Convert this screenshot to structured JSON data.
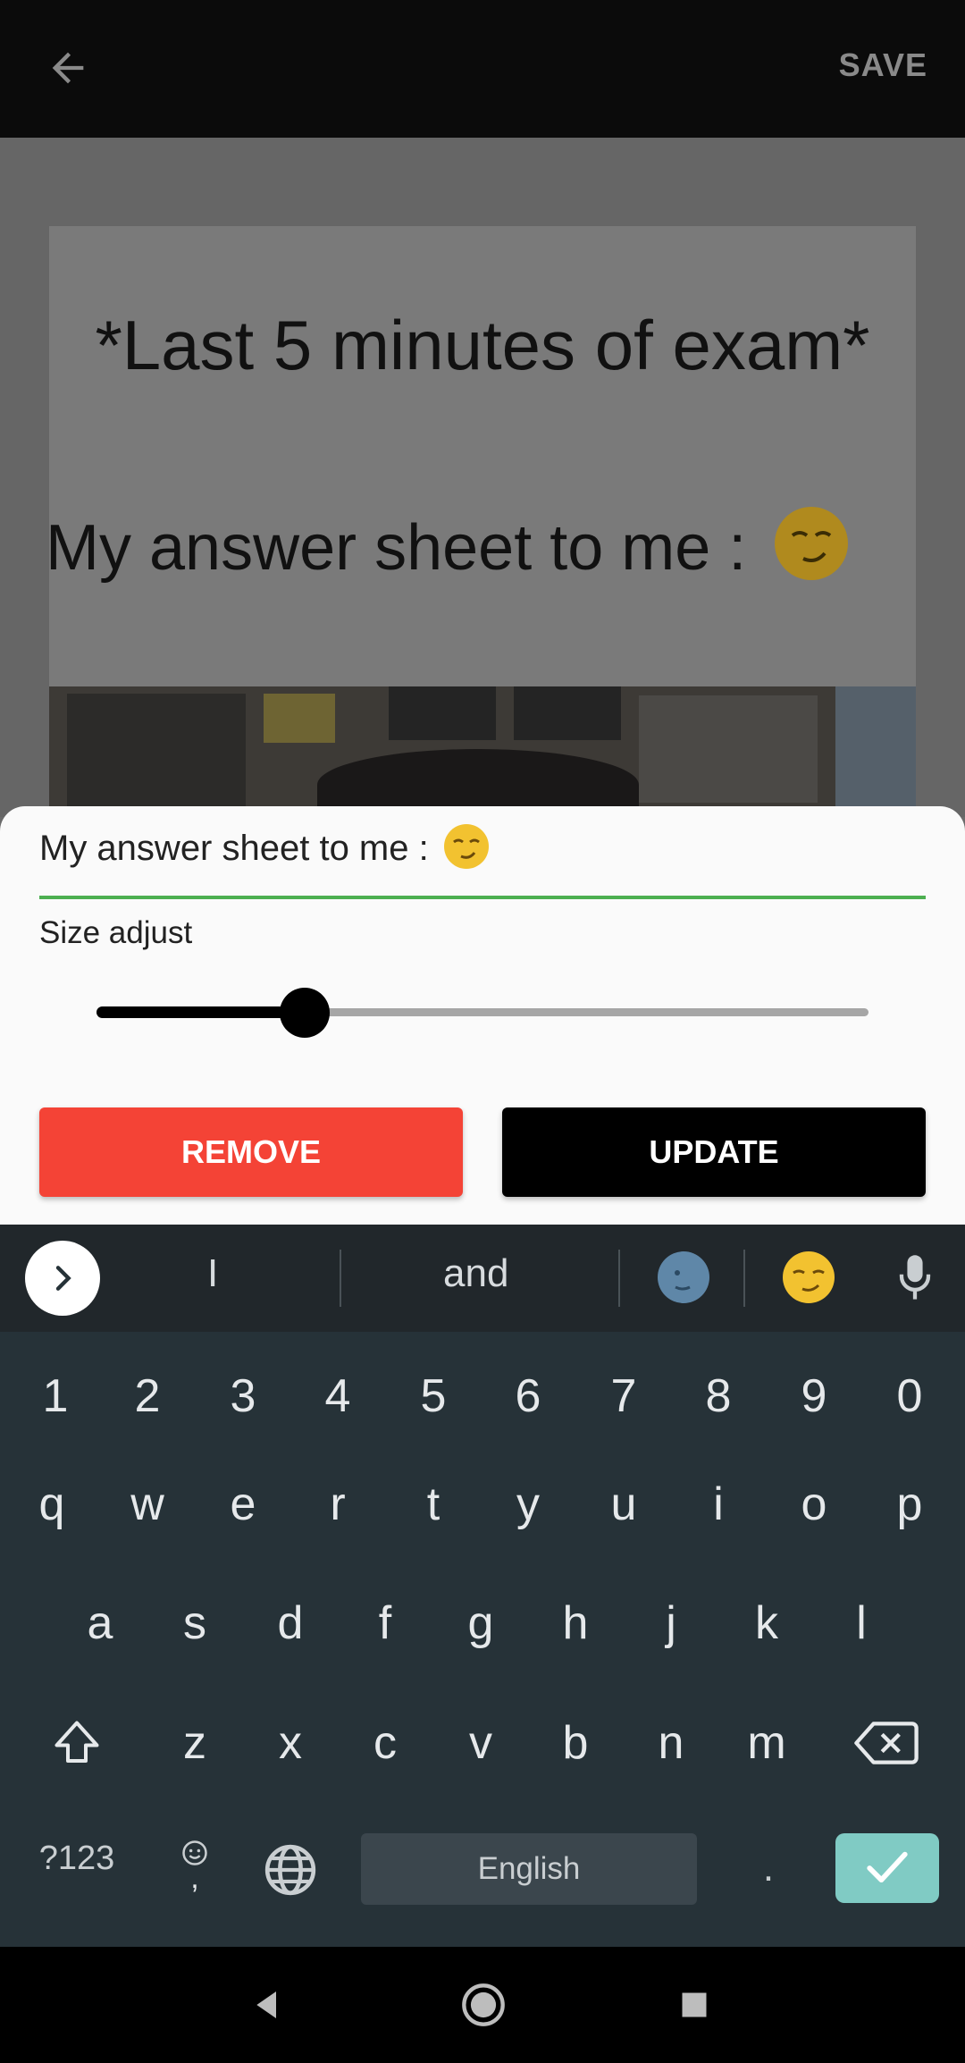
{
  "appbar": {
    "back_icon": "arrow-back-icon",
    "save_label": "SAVE"
  },
  "meme": {
    "line1": "*Last 5 minutes of exam*",
    "line2": "My answer sheet to me : ",
    "emoji": "smirking-face-emoji"
  },
  "editor": {
    "text_value": "My answer sheet to me : ",
    "underline_color": "#4caf50",
    "size_label": "Size adjust",
    "size_level_fraction": 0.27,
    "remove_label": "REMOVE",
    "update_label": "UPDATE",
    "remove_color": "#f44336",
    "update_color": "#000000"
  },
  "suggestions": {
    "words": [
      "I",
      "and"
    ],
    "emojis": [
      "new-moon-face-emoji",
      "smirking-face-emoji"
    ]
  },
  "keyboard": {
    "row_numbers": [
      "1",
      "2",
      "3",
      "4",
      "5",
      "6",
      "7",
      "8",
      "9",
      "0"
    ],
    "row_top": [
      "q",
      "w",
      "e",
      "r",
      "t",
      "y",
      "u",
      "i",
      "o",
      "p"
    ],
    "row_middle": [
      "a",
      "s",
      "d",
      "f",
      "g",
      "h",
      "j",
      "k",
      "l"
    ],
    "row_bottom": [
      "z",
      "x",
      "c",
      "v",
      "b",
      "n",
      "m"
    ],
    "symbols_label": "?123",
    "emoji_comma_label": ",",
    "space_label": "English",
    "period_label": ".",
    "enter_color": "#80cbc4"
  },
  "navbar": {
    "back": "nav-back-icon",
    "home": "nav-home-icon",
    "recents": "nav-recents-icon"
  }
}
